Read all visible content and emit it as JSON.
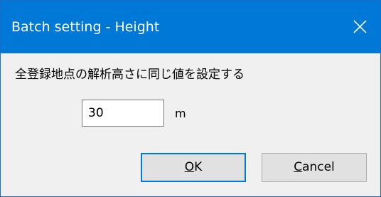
{
  "window": {
    "title": "Batch setting - Height"
  },
  "dialog": {
    "prompt": "全登録地点の解析高さに同じ値を設定する",
    "height_value": "30",
    "unit": "m"
  },
  "buttons": {
    "ok": {
      "mnemonic": "O",
      "rest": "K"
    },
    "cancel": {
      "mnemonic": "C",
      "rest": "ancel"
    }
  },
  "icons": {
    "close": "close-icon"
  },
  "colors": {
    "titlebar": "#0078d7",
    "title_text": "#ffffff",
    "client_bg": "#f0f0f0",
    "button_bg": "#e1e1e1",
    "default_button_border": "#0078d7"
  }
}
